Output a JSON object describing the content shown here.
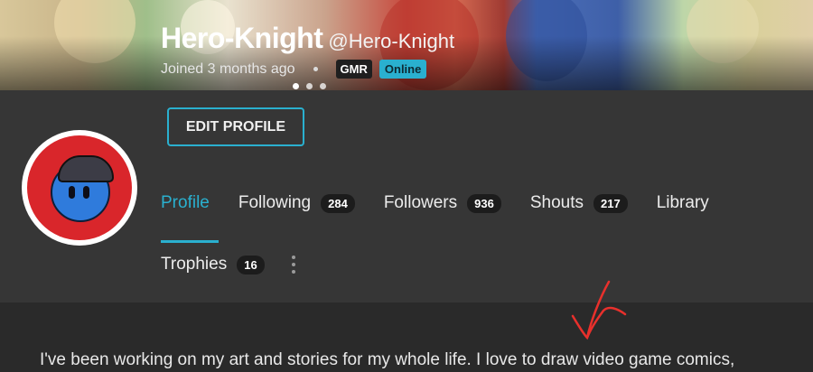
{
  "banner": {
    "display_name": "Hero-Knight",
    "handle": "@Hero-Knight",
    "joined": "Joined 3 months ago",
    "badges": [
      "GMR",
      "Online"
    ]
  },
  "profile": {
    "edit_label": "EDIT PROFILE"
  },
  "tabs": [
    {
      "label": "Profile",
      "count": null
    },
    {
      "label": "Following",
      "count": "284"
    },
    {
      "label": "Followers",
      "count": "936"
    },
    {
      "label": "Shouts",
      "count": "217"
    },
    {
      "label": "Library",
      "count": null
    }
  ],
  "tabs2": [
    {
      "label": "Trophies",
      "count": "16"
    }
  ],
  "bio": {
    "text": "I've been working on my art and stories for my whole life. I love to draw video game comics,"
  },
  "colors": {
    "accent": "#2ab0cf",
    "annotation": "#e8302c"
  },
  "icons": [
    "more-vertical-icon"
  ]
}
